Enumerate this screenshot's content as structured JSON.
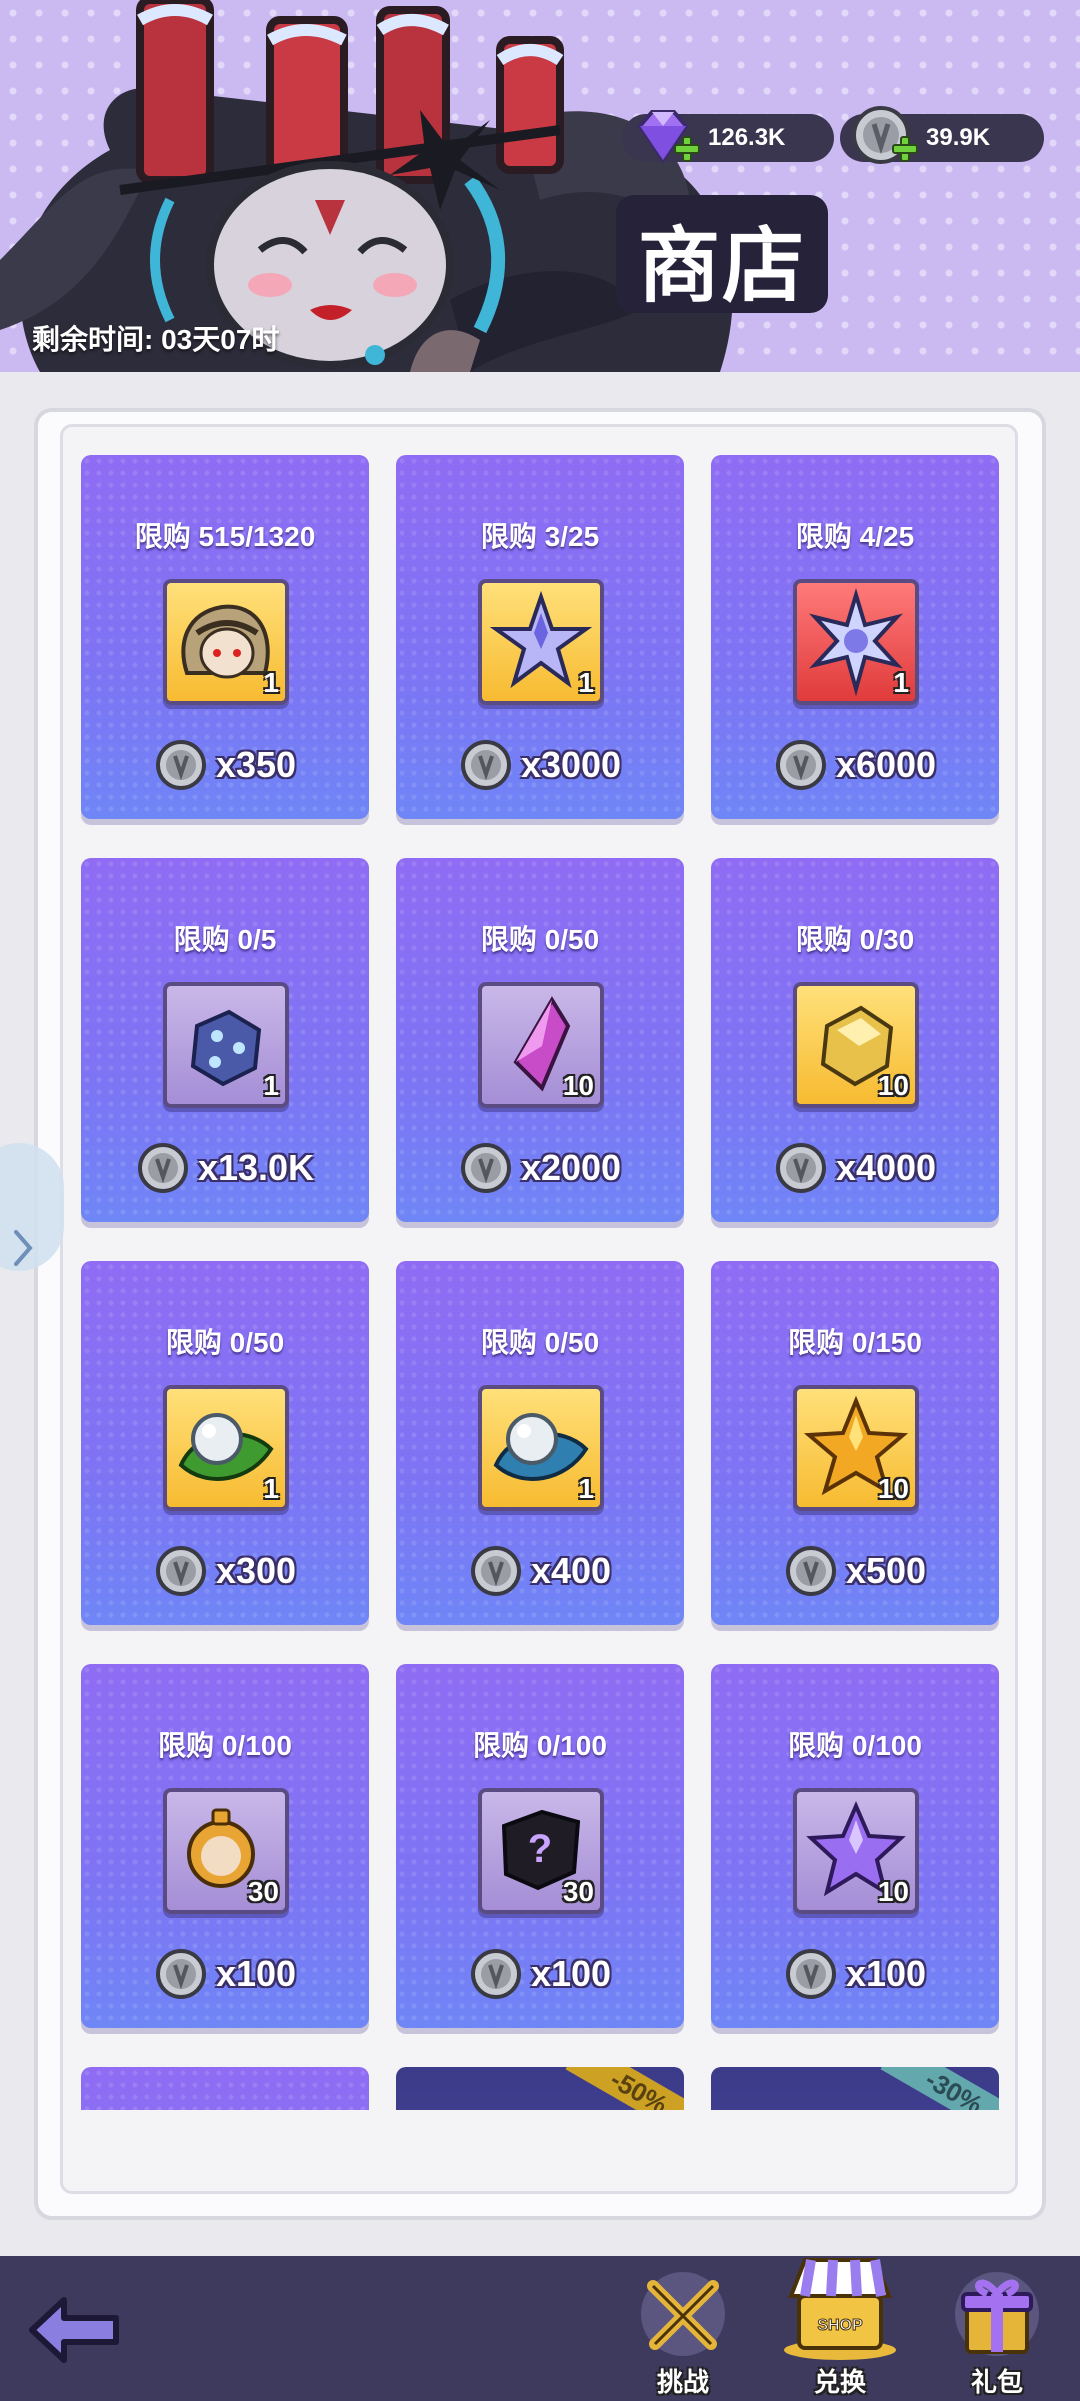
{
  "header": {
    "title": "商店",
    "timer": "剩余时间: 03天07时",
    "gems": "126.3K",
    "coins": "39.9K"
  },
  "items": [
    {
      "limit": "限购 515/1320",
      "qty": "1",
      "price": "x350",
      "icon": "hero-portrait-icon",
      "slot": "gold"
    },
    {
      "limit": "限购 3/25",
      "qty": "1",
      "price": "x3000",
      "icon": "crystal-star-icon",
      "slot": "gold"
    },
    {
      "limit": "限购 4/25",
      "qty": "1",
      "price": "x6000",
      "icon": "snowflake-crystal-icon",
      "slot": "red"
    },
    {
      "limit": "限购 0/5",
      "qty": "1",
      "price": "x13.0K",
      "icon": "ice-dice-icon",
      "slot": "lilac"
    },
    {
      "limit": "限购 0/50",
      "qty": "10",
      "price": "x2000",
      "icon": "purple-crystal-shard-icon",
      "slot": "lilac"
    },
    {
      "limit": "限购 0/30",
      "qty": "10",
      "price": "x4000",
      "icon": "gold-ore-icon",
      "slot": "gold"
    },
    {
      "limit": "限购 0/50",
      "qty": "1",
      "price": "x300",
      "icon": "green-leaf-pearl-icon",
      "slot": "gold"
    },
    {
      "limit": "限购 0/50",
      "qty": "1",
      "price": "x400",
      "icon": "blue-leaf-pearl-icon",
      "slot": "gold"
    },
    {
      "limit": "限购 0/150",
      "qty": "10",
      "price": "x500",
      "icon": "gold-star-icon",
      "slot": "gold"
    },
    {
      "limit": "限购 0/100",
      "qty": "30",
      "price": "x100",
      "icon": "hero-medallion-icon",
      "slot": "lilac"
    },
    {
      "limit": "限购 0/100",
      "qty": "30",
      "price": "x100",
      "icon": "mystery-fragment-icon",
      "slot": "lilac"
    },
    {
      "limit": "限购 0/100",
      "qty": "10",
      "price": "x100",
      "icon": "purple-star-icon",
      "slot": "lilac"
    }
  ],
  "partial_cards": [
    {
      "ribbon": ""
    },
    {
      "ribbon": "-50%"
    },
    {
      "ribbon": "-30%"
    }
  ],
  "nav": {
    "challenge": "挑战",
    "exchange": "兑换",
    "gift": "礼包",
    "shop_sign": "SHOP"
  },
  "colors": {
    "card_purple": "#8a6cf2",
    "slot_gold": "#f7bb31",
    "slot_red": "#e03b3b",
    "slot_lilac": "#a58ed6",
    "nav_bg": "#3e3a5e"
  }
}
